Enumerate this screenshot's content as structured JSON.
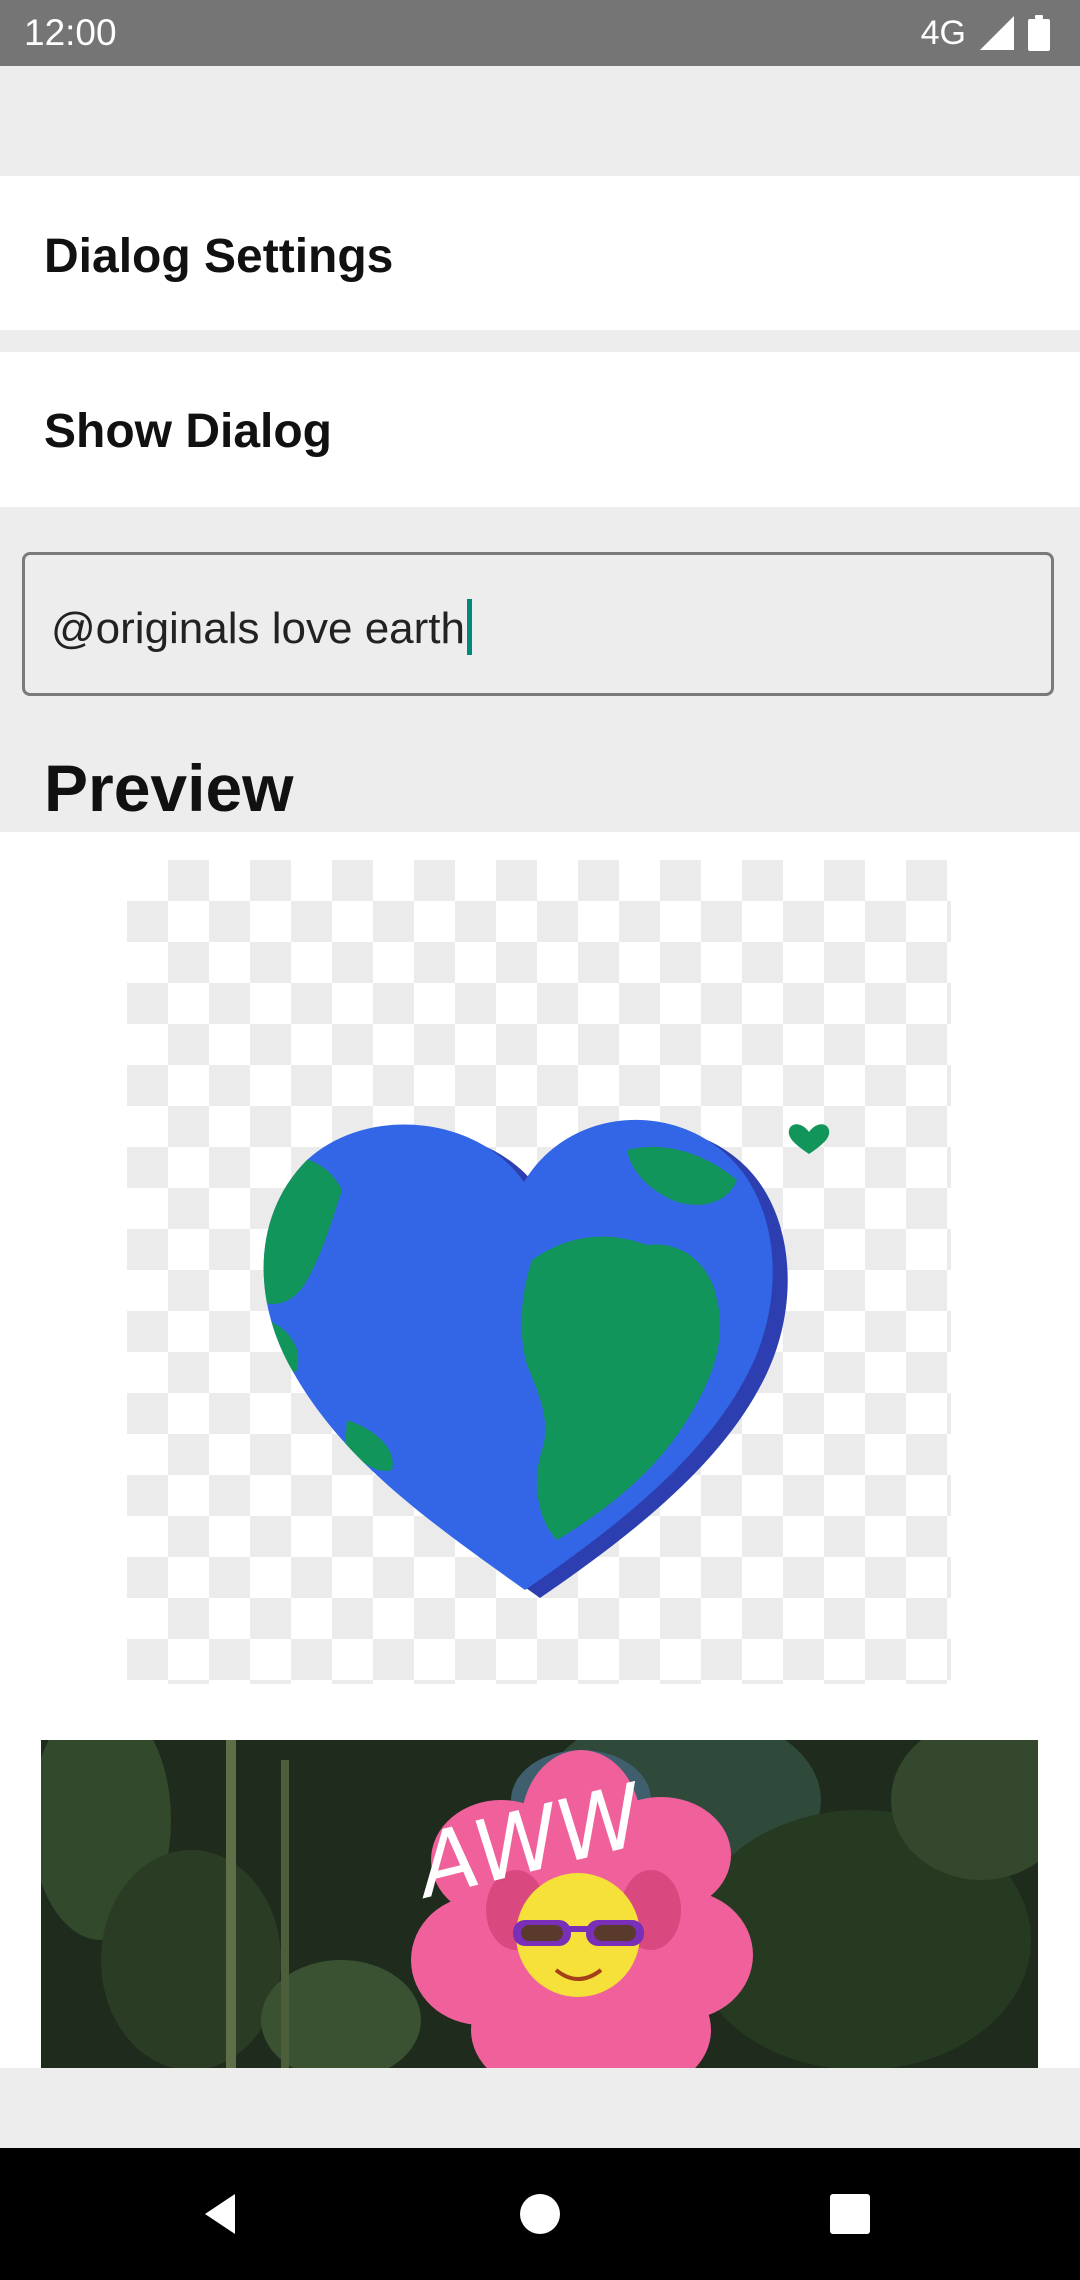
{
  "status_bar": {
    "time": "12:00",
    "network": "4G",
    "icons": [
      "signal-icon",
      "battery-icon"
    ]
  },
  "settings_row": {
    "label": "Dialog Settings"
  },
  "dialog_row": {
    "label": "Show Dialog"
  },
  "search": {
    "value": "@originals love earth"
  },
  "preview": {
    "title": "Preview",
    "items": [
      {
        "name": "heart-earth-sticker",
        "caption": ""
      },
      {
        "name": "aww-flower-gif",
        "caption": "AWW"
      }
    ]
  },
  "nav_bar": {
    "icons": [
      "back-icon",
      "home-icon",
      "recents-icon"
    ]
  },
  "colors": {
    "status_bar": "#757575",
    "background": "#ededed",
    "caret": "#00897b",
    "earth_ocean": "#3366e6",
    "earth_land": "#12955a",
    "flower": "#f0619c"
  }
}
